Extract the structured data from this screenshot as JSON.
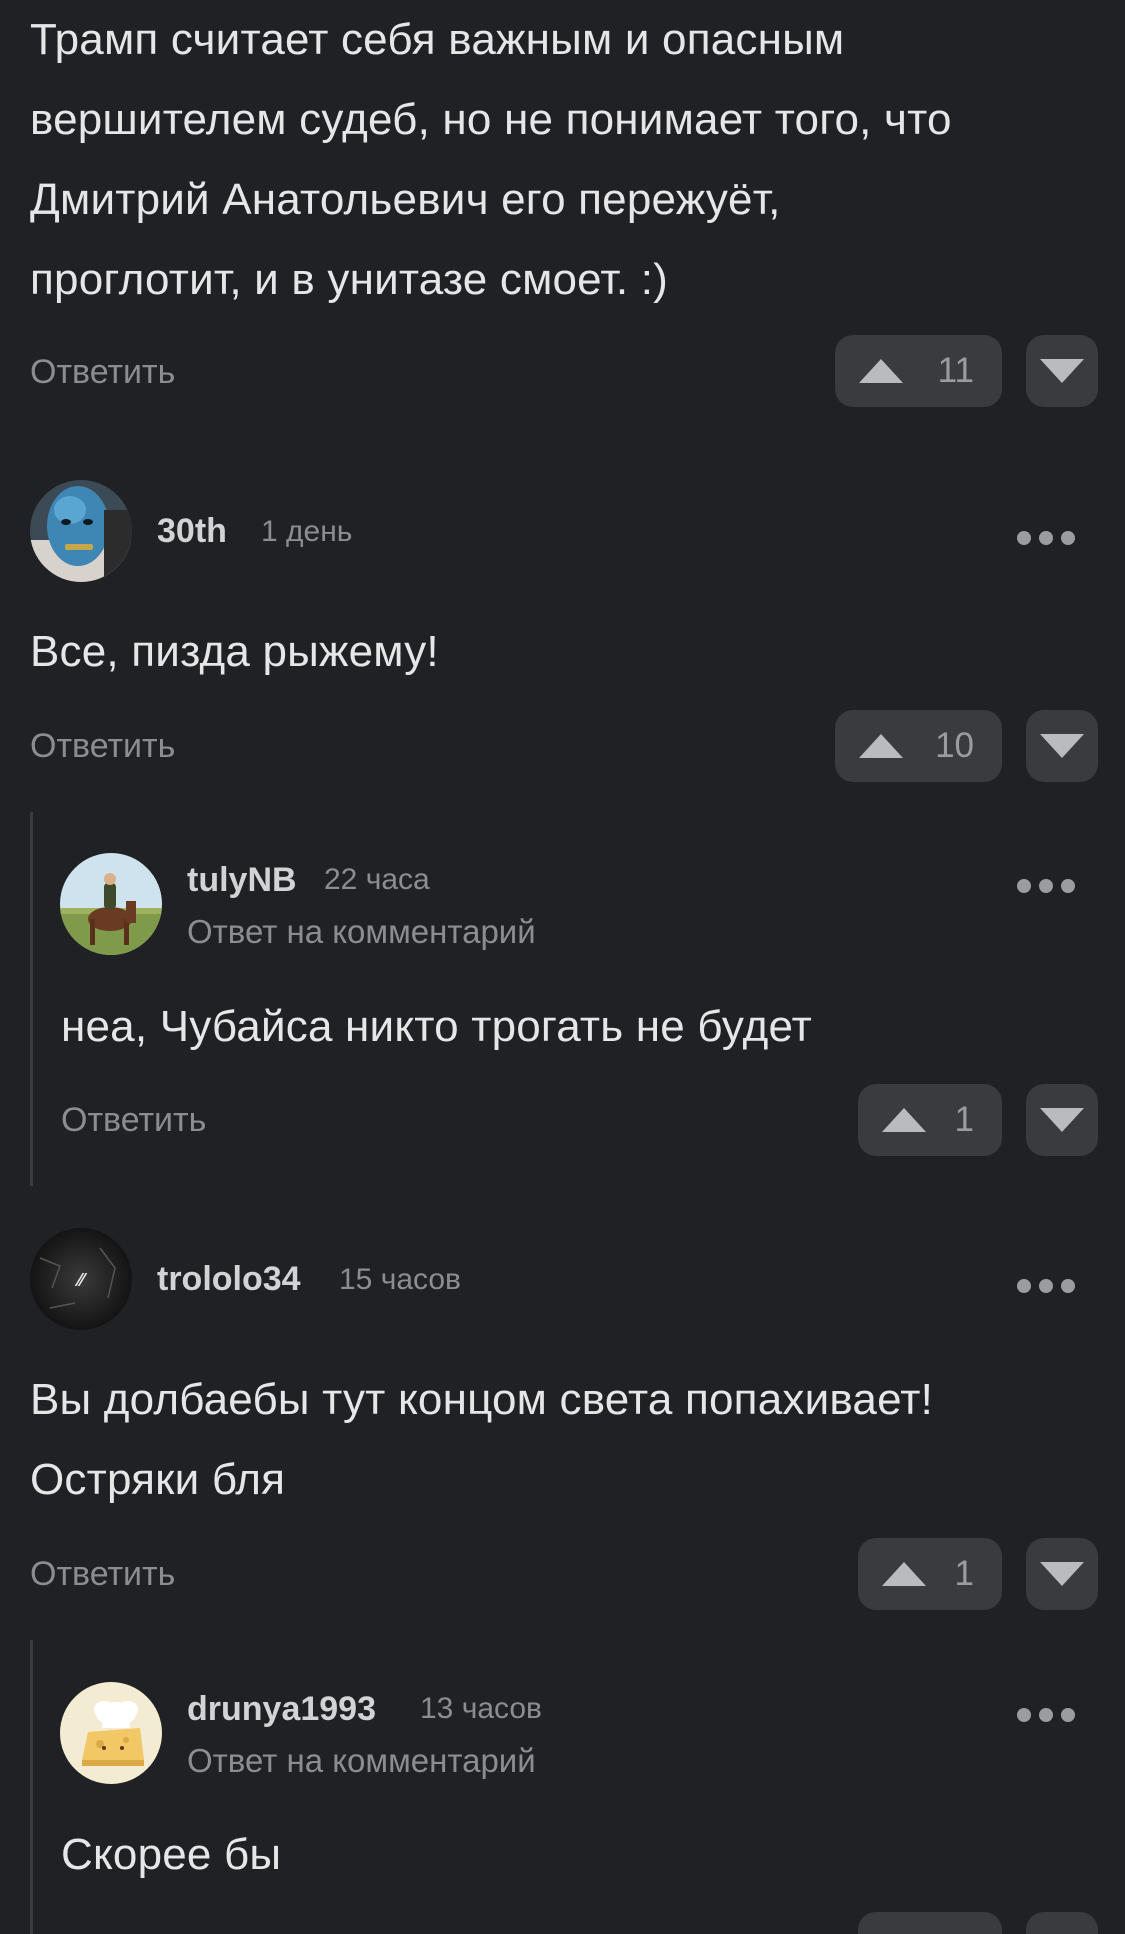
{
  "comments": [
    {
      "text_lines": [
        "Трамп считает себя важным и опасным",
        "вершителем судеб, но не понимает того, что",
        "Дмитрий Анатольевич его пережуёт,",
        "проглотит, и в унитазе смоет. :)"
      ],
      "reply_label": "Ответить",
      "rating": "11"
    },
    {
      "username": "30th",
      "time": "1 день",
      "avatar_icon": "blue-face-avatar",
      "text_lines": [
        "Все, пизда рыжему!"
      ],
      "reply_label": "Ответить",
      "rating": "10",
      "replies": [
        {
          "username": "tulyNB",
          "time": "22 часа",
          "reply_to": "Ответ на комментарий",
          "avatar_icon": "horse-rider-avatar",
          "text_lines": [
            "неа, Чубайса никто трогать не будет"
          ],
          "reply_label": "Ответить",
          "rating": "1"
        }
      ]
    },
    {
      "username": "trololo34",
      "time": "15 часов",
      "avatar_icon": "dark-texture-avatar",
      "text_lines": [
        "Вы долбаебы тут концом света попахивает!",
        "Остряки бля"
      ],
      "reply_label": "Ответить",
      "rating": "1",
      "replies": [
        {
          "username": "drunya1993",
          "time": "13 часов",
          "reply_to": "Ответ на комментарий",
          "avatar_icon": "cheese-chef-avatar",
          "text_lines": [
            "Скорее бы"
          ]
        }
      ]
    }
  ],
  "colors": {
    "background": "#1f2124",
    "button": "#393b3f",
    "muted_text": "#8b8d90",
    "body_text": "#e6e6e6"
  }
}
